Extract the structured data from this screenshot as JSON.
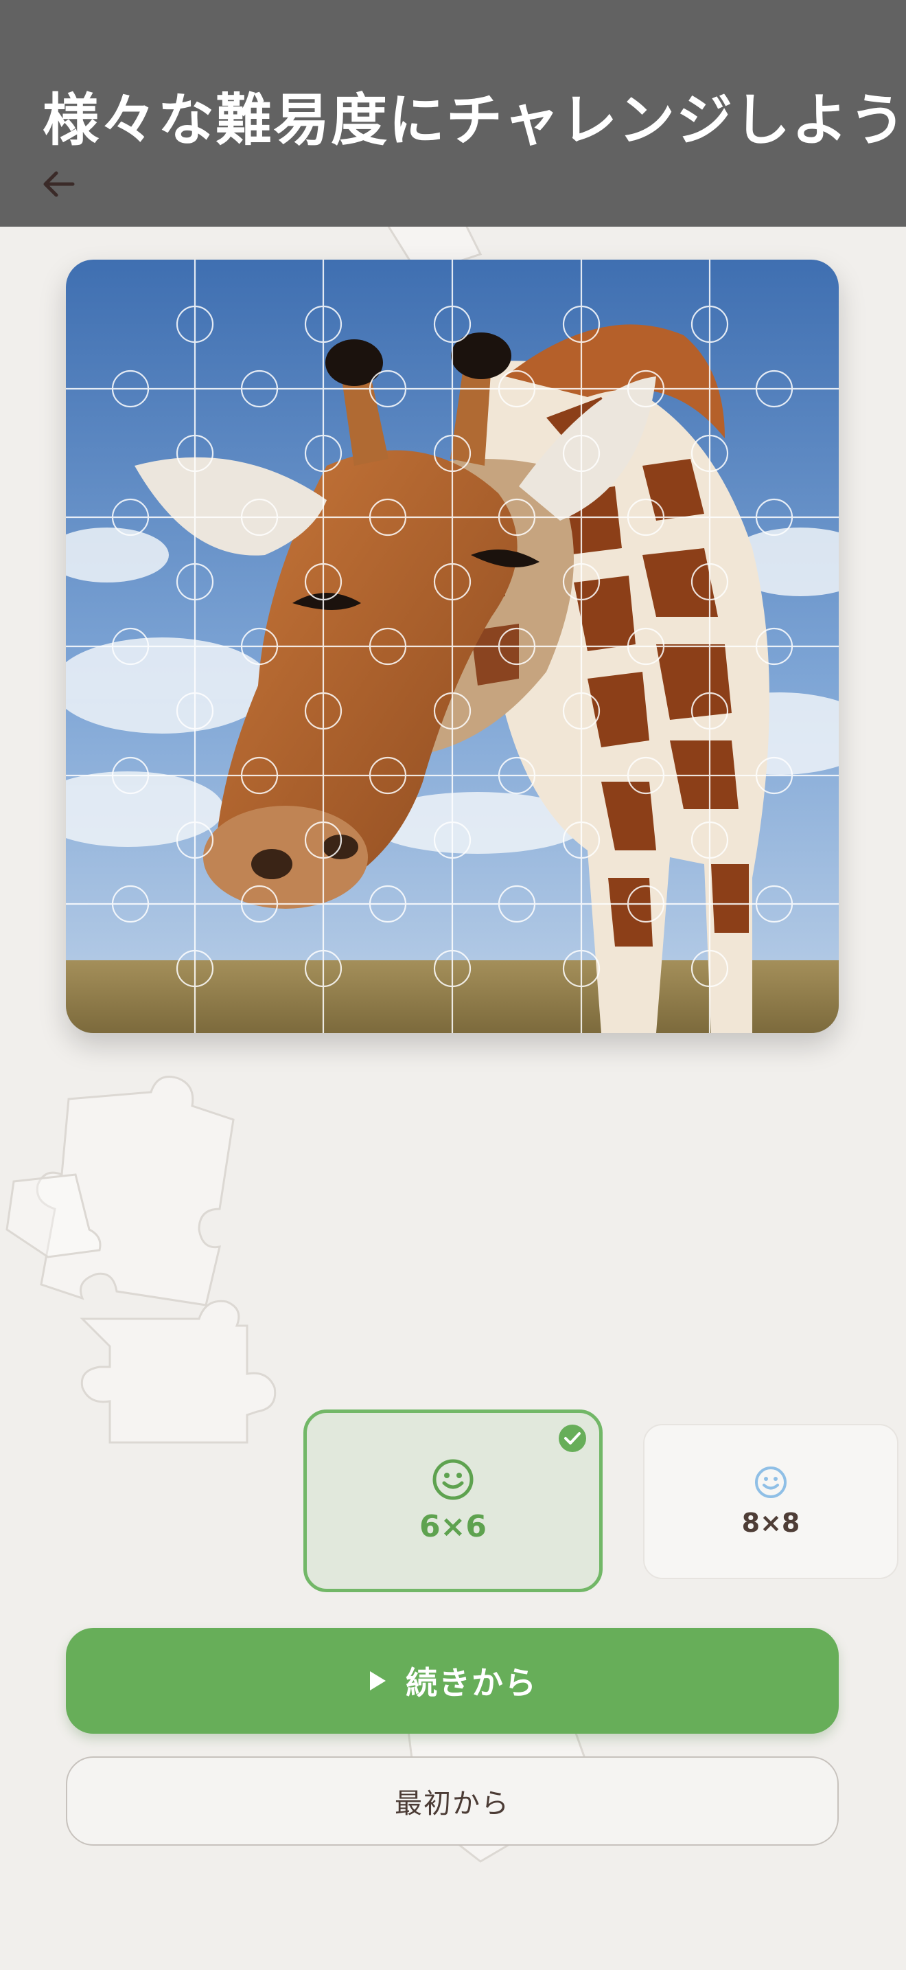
{
  "header": {
    "title": "様々な難易度にチャレンジしよう",
    "back_icon": "arrow-left-icon"
  },
  "puzzle": {
    "subject": "giraffe"
  },
  "difficulty": {
    "options": [
      {
        "label": "6×6",
        "icon": "smile-face-icon",
        "selected": true
      },
      {
        "label": "8×8",
        "icon": "smile-face-icon",
        "selected": false
      }
    ]
  },
  "actions": {
    "continue_label": "続きから",
    "restart_label": "最初から"
  },
  "colors": {
    "header": "#626262",
    "accent_green": "#67ae59",
    "selected_bg": "#e1e8dc",
    "text_brown": "#4e3d36",
    "icon_blue": "#8fbfe6"
  }
}
